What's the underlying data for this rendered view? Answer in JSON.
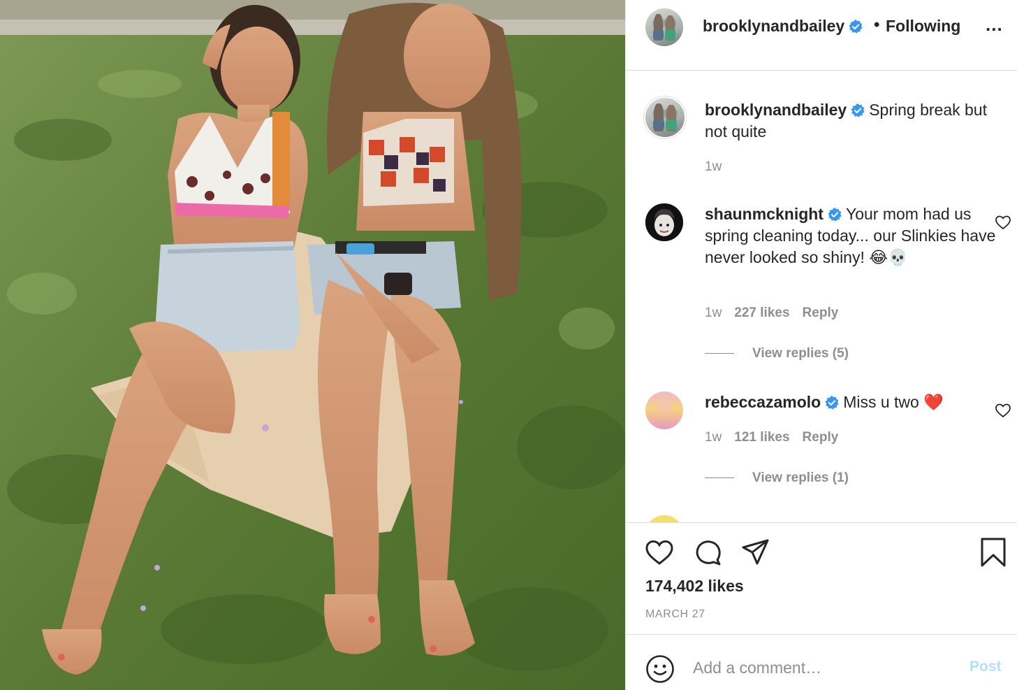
{
  "photo": {
    "description_icon": "post-photo"
  },
  "header": {
    "username": "brooklynandbailey",
    "separator": "•",
    "follow_state": "Following",
    "more_label": "..."
  },
  "caption": {
    "username": "brooklynandbailey",
    "text": "Spring break but not quite",
    "time": "1w"
  },
  "comments": [
    {
      "username": "shaunmcknight",
      "text": "Your mom had us spring cleaning today... our Slinkies have never looked so shiny! 😂💀",
      "time": "1w",
      "likes": "227 likes",
      "reply_label": "Reply",
      "view_replies": "View replies (5)"
    },
    {
      "username": "rebeccazamolo",
      "text": "Miss u two ❤️",
      "time": "1w",
      "likes": "121 likes",
      "reply_label": "Reply",
      "view_replies": "View replies (1)"
    }
  ],
  "actions": {
    "likes": "174,402 likes",
    "date": "MARCH 27"
  },
  "add_comment": {
    "placeholder": "Add a comment…",
    "post_label": "Post"
  },
  "colors": {
    "verified": "#3897f0",
    "muted": "#8e8e8e",
    "post_disabled": "#b2dffc",
    "heart_red": "#ed4956"
  }
}
